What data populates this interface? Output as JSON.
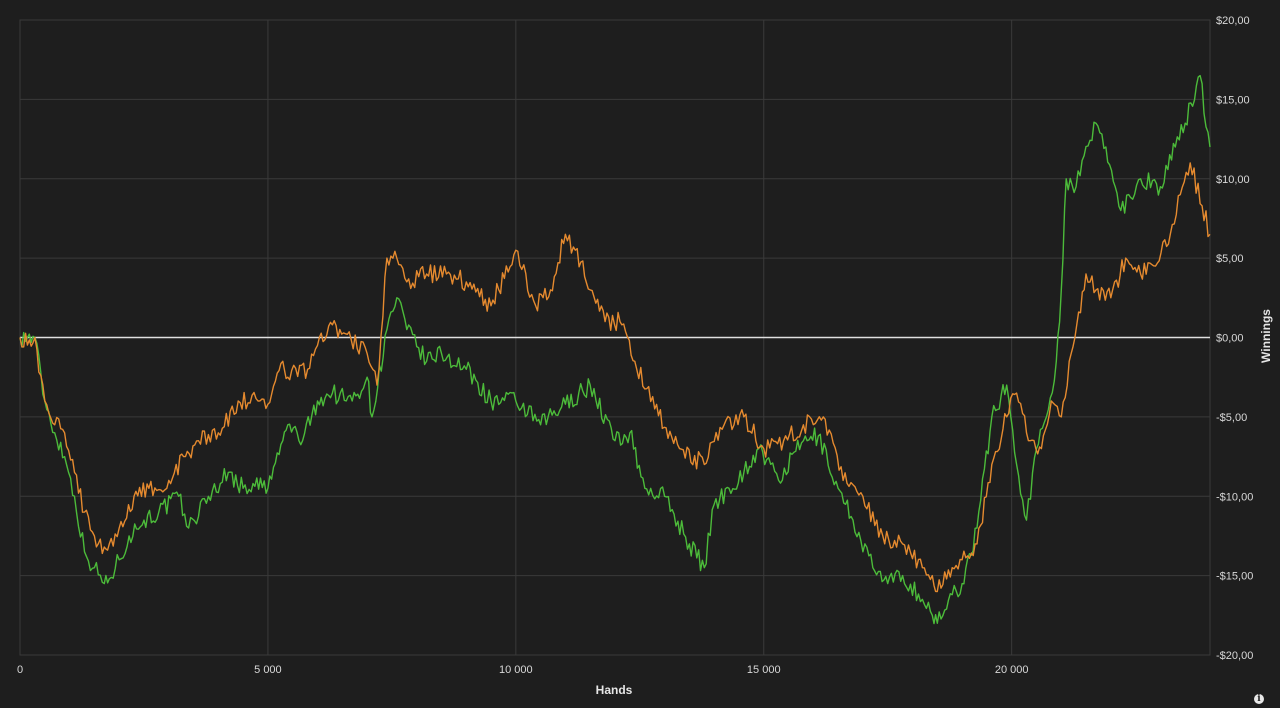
{
  "chart_data": {
    "type": "line",
    "xlabel": "Hands",
    "ylabel": "Winnings",
    "xlim": [
      0,
      24000
    ],
    "ylim": [
      -20,
      20
    ],
    "x_ticks": [
      0,
      5000,
      10000,
      15000,
      20000
    ],
    "x_tick_labels": [
      "0",
      "5 000",
      "10 000",
      "15 000",
      "20 000"
    ],
    "y_ticks": [
      20,
      15,
      10,
      5,
      0,
      -5,
      -10,
      -15,
      -20
    ],
    "y_tick_labels": [
      "$20,00",
      "$15,00",
      "$10,00",
      "$5,00",
      "$0,00",
      "-$5,00",
      "-$10,00",
      "-$15,00",
      "-$20,00"
    ],
    "grid": true,
    "reference_line": {
      "y": 0,
      "color": "#e0e0e0"
    },
    "series": [
      {
        "color": "#4cbb3a",
        "x": [
          0,
          300,
          500,
          700,
          900,
          1100,
          1300,
          1500,
          1700,
          1800,
          2000,
          2200,
          2500,
          2800,
          3200,
          3400,
          3800,
          4200,
          4500,
          4700,
          5000,
          5300,
          5400,
          5700,
          6000,
          6300,
          6700,
          7000,
          7100,
          7400,
          7600,
          7800,
          8200,
          8500,
          9000,
          9500,
          10000,
          10500,
          11000,
          11500,
          12000,
          12300,
          12600,
          13000,
          13500,
          13800,
          14000,
          14300,
          14600,
          14900,
          15300,
          15800,
          16100,
          16500,
          16800,
          17200,
          17500,
          17800,
          18200,
          18400,
          18500,
          18800,
          19000,
          19300,
          19600,
          19900,
          20100,
          20300,
          20500,
          20700,
          20900,
          21000,
          21100,
          21300,
          21700,
          21900,
          22200,
          22600,
          23000,
          23300,
          23500,
          23800,
          24000
        ],
        "values": [
          0,
          0,
          -4,
          -6,
          -7.5,
          -10,
          -13.5,
          -14.5,
          -15.5,
          -15.2,
          -14,
          -12.5,
          -11.5,
          -11,
          -10,
          -12,
          -10,
          -8.5,
          -9.5,
          -9.2,
          -9.5,
          -6.5,
          -5.5,
          -6.5,
          -4,
          -3.5,
          -4,
          -2.5,
          -5,
          0.5,
          2.5,
          0.5,
          -1.5,
          -1,
          -2,
          -4,
          -4,
          -5.5,
          -4.2,
          -3,
          -6.5,
          -6,
          -9.5,
          -10,
          -13,
          -14.5,
          -10.5,
          -9.5,
          -8.5,
          -7,
          -9,
          -6.5,
          -6.2,
          -9.5,
          -11.5,
          -14.5,
          -15.5,
          -15,
          -16.5,
          -17.5,
          -18,
          -16.2,
          -15.5,
          -12,
          -5,
          -3,
          -8,
          -11.5,
          -7,
          -5,
          -1.5,
          3,
          10,
          9.5,
          13.5,
          12,
          8,
          10,
          9.5,
          12,
          13.5,
          16.5,
          12
        ]
      },
      {
        "color": "#e58a2f",
        "x": [
          0,
          300,
          500,
          700,
          900,
          1100,
          1300,
          1500,
          1700,
          1800,
          2000,
          2300,
          2600,
          3000,
          3300,
          3600,
          4000,
          4400,
          4800,
          5000,
          5300,
          5400,
          5800,
          6000,
          6300,
          6600,
          7000,
          7200,
          7400,
          7600,
          7800,
          8200,
          8600,
          9000,
          9500,
          10000,
          10400,
          10700,
          11000,
          11200,
          11500,
          11800,
          12100,
          12400,
          12800,
          13300,
          13800,
          14200,
          14600,
          15000,
          15400,
          15800,
          16200,
          16600,
          17000,
          17400,
          17800,
          18200,
          18400,
          18500,
          18800,
          19000,
          19300,
          19600,
          19900,
          20100,
          20300,
          20600,
          20800,
          21000,
          21200,
          21500,
          21700,
          22000,
          22300,
          22600,
          22900,
          23200,
          23400,
          23600,
          24000
        ],
        "values": [
          0,
          0,
          -4,
          -5.5,
          -6,
          -8.5,
          -11,
          -12.5,
          -13.2,
          -13,
          -12,
          -10,
          -9.5,
          -9,
          -7.5,
          -6.5,
          -6,
          -4,
          -4,
          -4.2,
          -1.5,
          -2.5,
          -2,
          -0.5,
          0.8,
          0.2,
          -1,
          -3,
          5,
          5,
          3.5,
          4,
          4,
          3.5,
          2,
          5.5,
          2,
          3,
          6.5,
          5.5,
          3,
          1,
          1,
          -1.5,
          -4.5,
          -7,
          -8,
          -5.5,
          -5,
          -7,
          -6.5,
          -5.5,
          -5,
          -9,
          -10,
          -12.5,
          -13,
          -14.5,
          -15,
          -16,
          -14.5,
          -14,
          -13,
          -8,
          -5,
          -3.5,
          -6,
          -7,
          -4,
          -5,
          -1,
          4,
          3,
          2.5,
          5,
          4,
          4.5,
          6.5,
          9,
          11,
          6.5
        ]
      }
    ]
  },
  "info_icon": "info-icon"
}
